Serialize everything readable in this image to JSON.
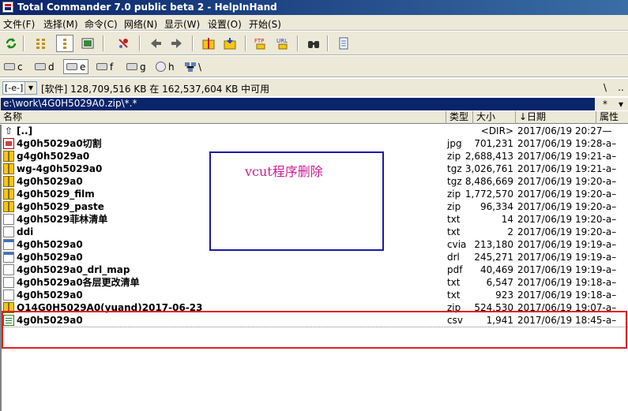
{
  "window": {
    "title": "Total Commander 7.0 public beta 2 - HelpInHand"
  },
  "menu": [
    "文件(F)",
    "选择(M)",
    "命令(C)",
    "网络(N)",
    "显示(W)",
    "设置(O)",
    "开始(S)"
  ],
  "toolbar_icons": [
    "refresh-icon",
    "brief-view-icon",
    "detailed-view-icon",
    "thumbnail-view-icon",
    "invert-selection-icon",
    "back-icon",
    "forward-icon",
    "pack-icon",
    "unpack-icon",
    "ftp-icon",
    "url-icon",
    "find-icon",
    "notepad-icon"
  ],
  "drives": [
    {
      "label": "c",
      "active": false
    },
    {
      "label": "d",
      "active": false
    },
    {
      "label": "e",
      "active": true
    },
    {
      "label": "f",
      "active": false
    },
    {
      "label": "g",
      "active": false
    },
    {
      "label": "h",
      "active": false
    },
    {
      "label": "\\",
      "active": false
    }
  ],
  "drive_select": {
    "value": "[-e-]",
    "arrow": "▼"
  },
  "free_space": "[软件]  128,709,516 KB 在 162,537,604 KB 中可用",
  "root_button": "\\",
  "parent_button": "..",
  "path": "e:\\work\\4G0H5029A0.zip\\*.*",
  "history_button": "*",
  "favorites_button": "▾",
  "headers": {
    "name": "名称",
    "ext": "类型",
    "size": "大小",
    "date": "↓日期",
    "attr": "属性"
  },
  "files": [
    {
      "name": "[..]",
      "ext": "",
      "size": "<DIR>",
      "date": "2017/06/19 20:27—",
      "icon": "up"
    },
    {
      "name": "4g0h5029a0切割",
      "ext": "jpg",
      "size": "701,231",
      "date": "2017/06/19 19:28-a–",
      "icon": "img"
    },
    {
      "name": "g4g0h5029a0",
      "ext": "zip",
      "size": "2,688,413",
      "date": "2017/06/19 19:21-a–",
      "icon": "zip"
    },
    {
      "name": "wg-4g0h5029a0",
      "ext": "tgz",
      "size": "3,026,761",
      "date": "2017/06/19 19:21-a–",
      "icon": "zip"
    },
    {
      "name": "4g0h5029a0",
      "ext": "tgz",
      "size": "8,486,669",
      "date": "2017/06/19 19:20-a–",
      "icon": "zip"
    },
    {
      "name": "4g0h5029_film",
      "ext": "zip",
      "size": "1,772,570",
      "date": "2017/06/19 19:20-a–",
      "icon": "zip"
    },
    {
      "name": "4g0h5029_paste",
      "ext": "zip",
      "size": "96,334",
      "date": "2017/06/19 19:20-a–",
      "icon": "zip"
    },
    {
      "name": "4g0h5029菲林清单",
      "ext": "txt",
      "size": "14",
      "date": "2017/06/19 19:20-a–",
      "icon": "txt"
    },
    {
      "name": "ddi",
      "ext": "txt",
      "size": "2",
      "date": "2017/06/19 19:20-a–",
      "icon": "txt"
    },
    {
      "name": "4g0h5029a0",
      "ext": "cvia",
      "size": "213,180",
      "date": "2017/06/19 19:19-a–",
      "icon": "cvia"
    },
    {
      "name": "4g0h5029a0",
      "ext": "drl",
      "size": "245,271",
      "date": "2017/06/19 19:19-a–",
      "icon": "cvia"
    },
    {
      "name": "4g0h5029a0_drl_map",
      "ext": "pdf",
      "size": "40,469",
      "date": "2017/06/19 19:19-a–",
      "icon": "txt"
    },
    {
      "name": "4g0h5029a0各层更改清单",
      "ext": "txt",
      "size": "6,547",
      "date": "2017/06/19 19:18-a–",
      "icon": "txt"
    },
    {
      "name": "4g0h5029a0",
      "ext": "txt",
      "size": "923",
      "date": "2017/06/19 19:18-a–",
      "icon": "txt"
    },
    {
      "name": "Q14G0H5029A0(yuand)2017-06-23",
      "ext": "zip",
      "size": "524,530",
      "date": "2017/06/19 19:07-a–",
      "icon": "zip"
    },
    {
      "name": "4g0h5029a0",
      "ext": "csv",
      "size": "1,941",
      "date": "2017/06/19 18:45-a–",
      "icon": "csv"
    }
  ],
  "annotation": {
    "text": "vcut程序删除",
    "box_color": "#1a1aa8",
    "text_color": "#cc1a99",
    "highlight_color": "#e02020"
  }
}
